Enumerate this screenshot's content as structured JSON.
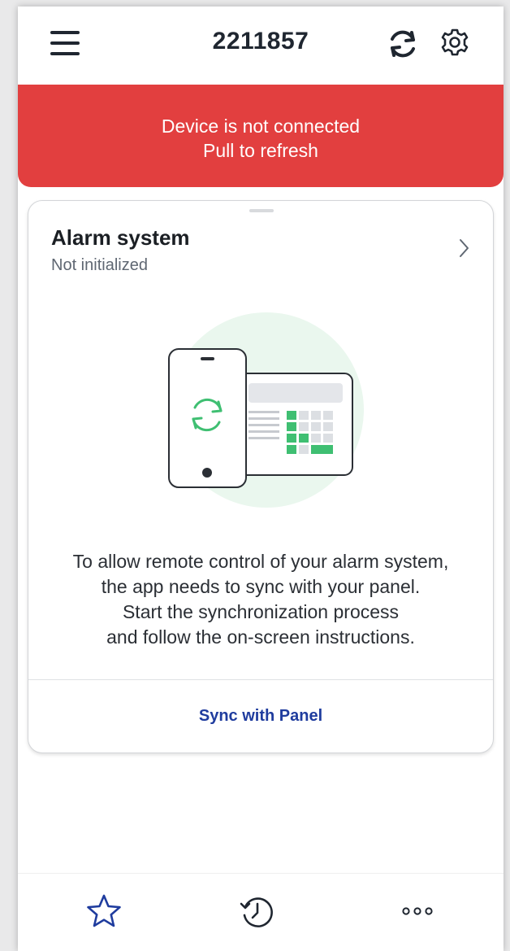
{
  "header": {
    "title": "2211857",
    "menu_icon": "hamburger-menu-icon",
    "refresh_icon": "refresh-icon",
    "settings_icon": "gear-icon"
  },
  "banner": {
    "line1": "Device is not connected",
    "line2": "Pull to refresh",
    "color": "#e23f3f"
  },
  "card": {
    "title": "Alarm system",
    "subtitle": "Not initialized",
    "description_lines": [
      "To allow remote control of your alarm system,",
      "the app needs to sync with your panel.",
      "Start the synchronization process",
      "and follow the on-screen instructions."
    ],
    "action_label": "Sync with Panel",
    "accent_color": "#1f3c9e",
    "illustration_accent": "#3fbf72"
  },
  "bottom_nav": {
    "items": [
      {
        "icon": "star-icon"
      },
      {
        "icon": "history-icon"
      },
      {
        "icon": "more-dots-icon"
      }
    ]
  }
}
